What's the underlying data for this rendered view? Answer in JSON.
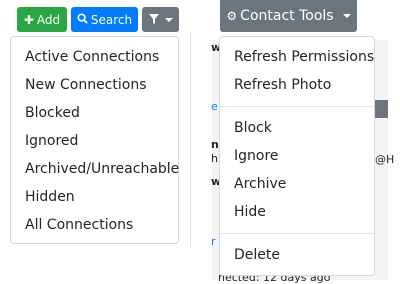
{
  "toolbar": {
    "add_label": "Add",
    "search_label": "Search"
  },
  "contact_tools": {
    "label": "Contact Tools"
  },
  "filter_menu": {
    "items": [
      {
        "label": "Active Connections"
      },
      {
        "label": "New Connections"
      },
      {
        "label": "Blocked"
      },
      {
        "label": "Ignored"
      },
      {
        "label": "Archived/Unreachable"
      },
      {
        "label": "Hidden"
      },
      {
        "label": "All Connections"
      }
    ]
  },
  "tools_menu": {
    "group1": [
      {
        "label": "Refresh Permissions"
      },
      {
        "label": "Refresh Photo"
      }
    ],
    "group2": [
      {
        "label": "Block"
      },
      {
        "label": "Ignore"
      },
      {
        "label": "Archive"
      },
      {
        "label": "Hide"
      }
    ],
    "group3": [
      {
        "label": "Delete"
      }
    ]
  },
  "background": {
    "frag_w1": "w",
    "frag_e": "e",
    "frag_n": "n",
    "frag_h": "h",
    "frag_w2": "w",
    "frag_at": "@H",
    "frag_r": "r",
    "frag_bottom": "nected: 12 days ago"
  },
  "colors": {
    "add": "#28a745",
    "search": "#007bff",
    "secondary": "#6c757d"
  },
  "icons": {
    "add": "plus-icon",
    "search": "search-icon",
    "filter": "filter-icon",
    "contact": "gear-icon"
  }
}
